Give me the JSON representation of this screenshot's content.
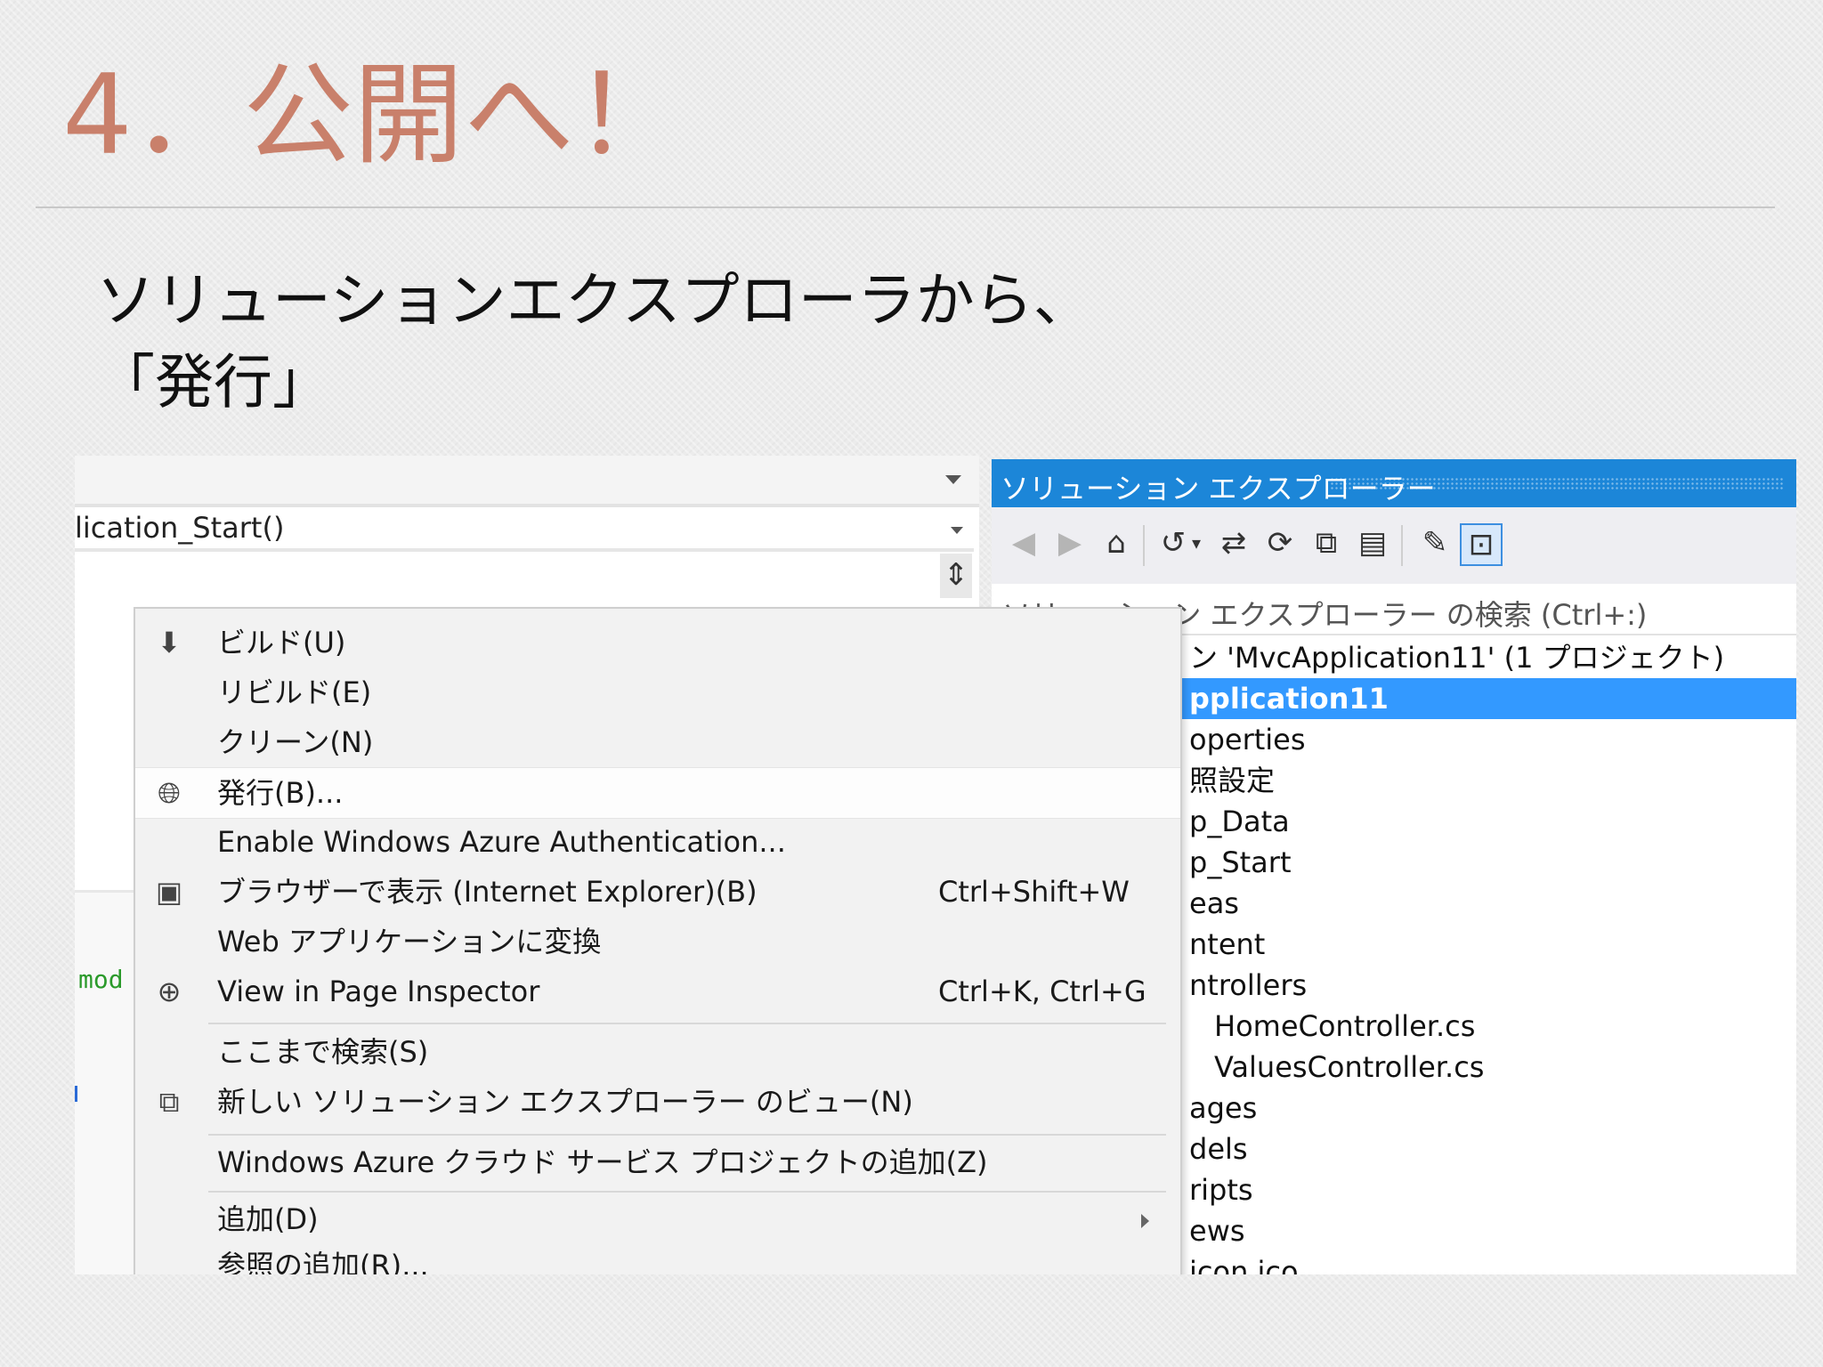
{
  "slide": {
    "title": "4．公開へ！",
    "subtitle_line1": "ソリューションエクスプローラから、",
    "subtitle_line2": "「発行」"
  },
  "editor": {
    "method_combo": "lication_Start()",
    "code_fragment": "mod"
  },
  "solution_explorer": {
    "title": "ソリューション エクスプローラー",
    "toolbar_icons": [
      "back-icon",
      "forward-icon",
      "home-icon",
      "history-icon",
      "sync-icon",
      "refresh-icon",
      "collapse-all-icon",
      "show-all-files-icon",
      "properties-icon",
      "preview-icon"
    ],
    "search_placeholder": "ソリューション エクスプローラー の検索 (Ctrl+:)",
    "tree": [
      {
        "text": "ン 'MvcApplication11' (1 プロジェクト)",
        "selected": false
      },
      {
        "text": "pplication11",
        "selected": true
      },
      {
        "text": "operties",
        "selected": false
      },
      {
        "text": "照設定",
        "selected": false
      },
      {
        "text": "p_Data",
        "selected": false
      },
      {
        "text": "p_Start",
        "selected": false
      },
      {
        "text": "eas",
        "selected": false
      },
      {
        "text": "ntent",
        "selected": false
      },
      {
        "text": "ntrollers",
        "selected": false
      },
      {
        "text": "HomeController.cs",
        "selected": false
      },
      {
        "text": "ValuesController.cs",
        "selected": false
      },
      {
        "text": "ages",
        "selected": false
      },
      {
        "text": "dels",
        "selected": false
      },
      {
        "text": "ripts",
        "selected": false
      },
      {
        "text": "ews",
        "selected": false
      },
      {
        "text": "icon.ico",
        "selected": false
      }
    ]
  },
  "context_menu": {
    "items": [
      {
        "label": "ビルド(U)",
        "icon": "build-icon",
        "shortcut": ""
      },
      {
        "label": "リビルド(E)",
        "icon": "",
        "shortcut": ""
      },
      {
        "label": "クリーン(N)",
        "icon": "",
        "shortcut": ""
      },
      {
        "label": "発行(B)...",
        "icon": "publish-icon",
        "shortcut": ""
      },
      {
        "label": "Enable Windows Azure Authentication...",
        "icon": "",
        "shortcut": ""
      },
      {
        "label": "ブラウザーで表示 (Internet Explorer)(B)",
        "icon": "browser-icon",
        "shortcut": "Ctrl+Shift+W"
      },
      {
        "label": "Web アプリケーションに変換",
        "icon": "",
        "shortcut": ""
      },
      {
        "label": "View in Page Inspector",
        "icon": "page-inspector-icon",
        "shortcut": "Ctrl+K, Ctrl+G"
      },
      {
        "label": "ここまで検索(S)",
        "icon": "",
        "shortcut": ""
      },
      {
        "label": "新しい ソリューション エクスプローラー のビュー(N)",
        "icon": "new-view-icon",
        "shortcut": ""
      },
      {
        "label": "Windows Azure クラウド サービス プロジェクトの追加(Z)",
        "icon": "",
        "shortcut": ""
      },
      {
        "label": "追加(D)",
        "icon": "",
        "shortcut": ""
      },
      {
        "label": "参照の追加(R)...",
        "icon": "",
        "shortcut": ""
      }
    ]
  },
  "colors": {
    "title": "#c9806b",
    "accent": "#1c86d8",
    "selection": "#3399ff"
  }
}
